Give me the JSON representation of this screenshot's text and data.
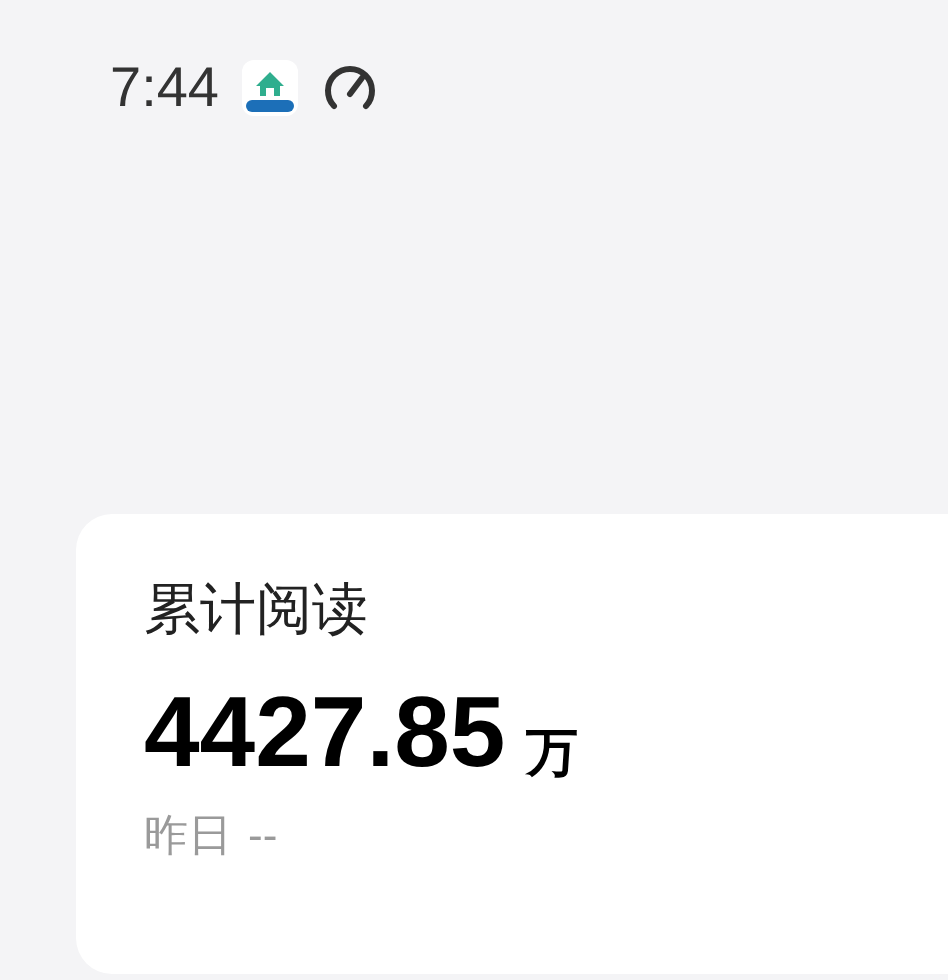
{
  "status_bar": {
    "time": "7:44"
  },
  "card": {
    "title": "累计阅读",
    "value": "4427.85",
    "unit": "万",
    "yesterday_label": "昨日",
    "yesterday_value": "--"
  }
}
